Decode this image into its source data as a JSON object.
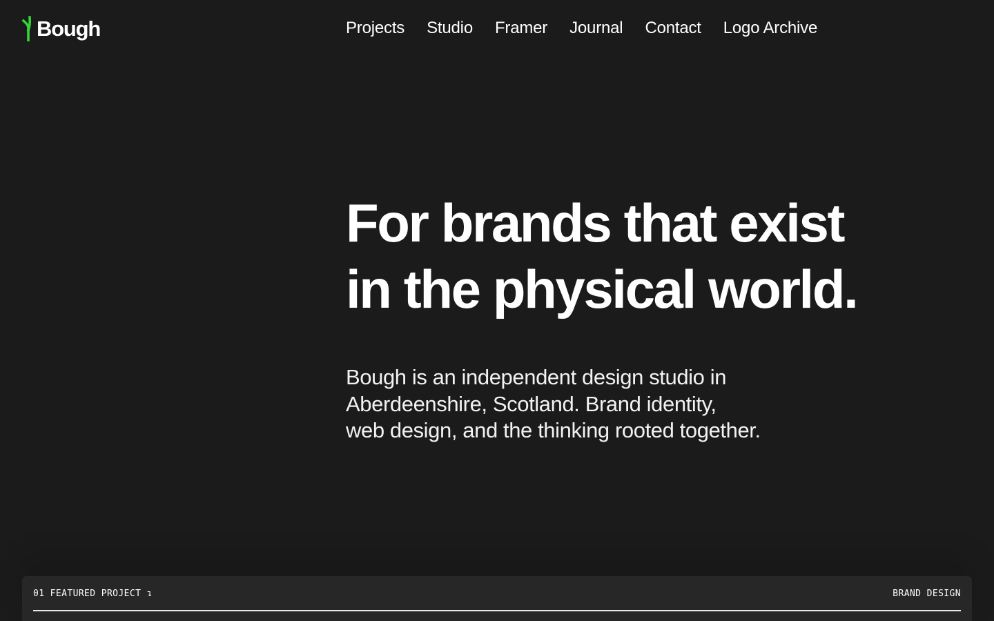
{
  "brand": {
    "name": "Bough",
    "accent_color": "#35d33a",
    "icon": "sprout-icon"
  },
  "nav": {
    "items": [
      {
        "label": "Projects"
      },
      {
        "label": "Studio"
      },
      {
        "label": "Framer"
      },
      {
        "label": "Journal"
      },
      {
        "label": "Contact"
      },
      {
        "label": "Logo Archive"
      }
    ]
  },
  "hero": {
    "title_lines": [
      "For brands that exist",
      "in the physical world."
    ],
    "body_lines": [
      "Bough is an independent design studio in",
      "Aberdeenshire, Scotland. Brand identity,",
      "web design, and the thinking rooted together."
    ]
  },
  "featured": {
    "label": "01 FEATURED PROJECT ↴",
    "category": "BRAND DESIGN"
  },
  "colors": {
    "background": "#1b1b1b",
    "card": "#272727",
    "text": "#ffffff"
  }
}
